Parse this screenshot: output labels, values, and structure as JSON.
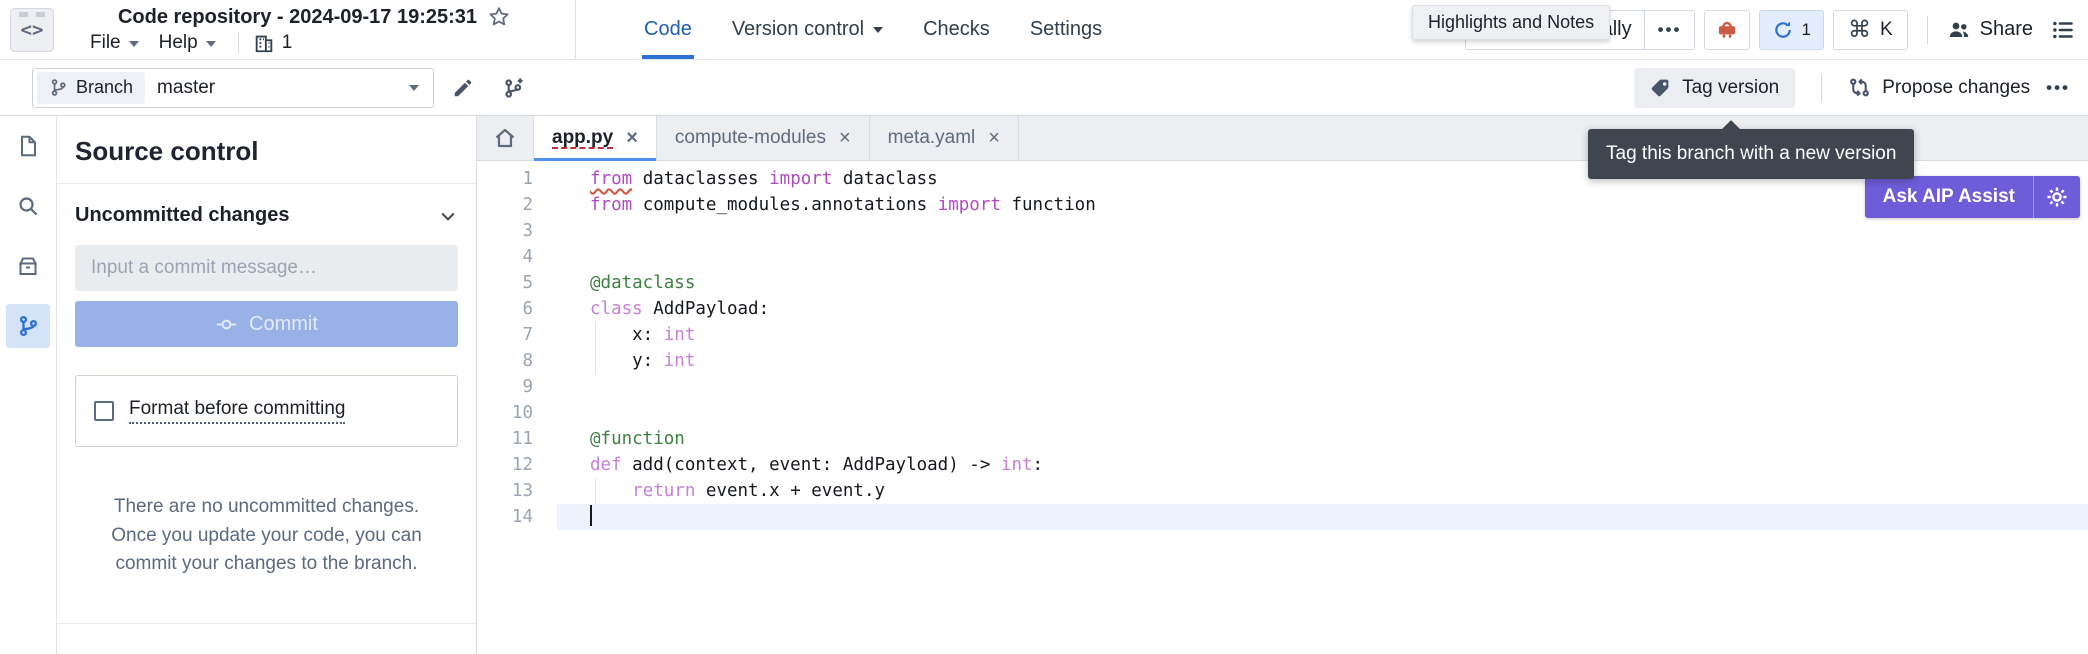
{
  "window": {
    "title": "Code repository - 2024-09-17 19:25:31"
  },
  "menubar": {
    "file_label": "File",
    "help_label": "Help",
    "resource_count": "1"
  },
  "nav": {
    "tabs": [
      {
        "label": "Code",
        "active": true
      },
      {
        "label": "Version control",
        "has_caret": true
      },
      {
        "label": "Checks"
      },
      {
        "label": "Settings"
      }
    ]
  },
  "top_actions": {
    "tooltip_text": "Highlights and Notes",
    "partial_button_label": "ally",
    "more_label": "•••",
    "build_count": "1",
    "shortcut_modifier": "⌘",
    "shortcut_key": "K",
    "share_label": "Share"
  },
  "branch_bar": {
    "branch_chip_label": "Branch",
    "branch_name": "master",
    "tag_version_label": "Tag version",
    "propose_changes_label": "Propose changes",
    "more_label": "•••"
  },
  "tag_tooltip": {
    "text": "Tag this branch with a new version"
  },
  "aip_assist": {
    "label": "Ask AIP Assist"
  },
  "source_control": {
    "title": "Source control",
    "section_title": "Uncommitted changes",
    "commit_placeholder": "Input a commit message…",
    "commit_label": "Commit",
    "format_label": "Format before committing",
    "empty_state_text": "There are no uncommitted changes. Once you update your code, you can commit your changes to the branch."
  },
  "editor": {
    "tabs": [
      {
        "label": "app.py",
        "active": true,
        "error_underline": true
      },
      {
        "label": "compute-modules"
      },
      {
        "label": "meta.yaml"
      }
    ],
    "code": {
      "language": "python",
      "current_line": 14,
      "lines": [
        {
          "n": 1,
          "tokens": [
            {
              "c": "k e",
              "t": "from"
            },
            {
              "c": "t",
              "t": " dataclasses "
            },
            {
              "c": "k",
              "t": "import"
            },
            {
              "c": "t",
              "t": " dataclass"
            }
          ]
        },
        {
          "n": 2,
          "tokens": [
            {
              "c": "k",
              "t": "from"
            },
            {
              "c": "t",
              "t": " compute_modules.annotations "
            },
            {
              "c": "k",
              "t": "import"
            },
            {
              "c": "t",
              "t": " function"
            }
          ]
        },
        {
          "n": 3,
          "tokens": []
        },
        {
          "n": 4,
          "tokens": []
        },
        {
          "n": 5,
          "tokens": [
            {
              "c": "d",
              "t": "@dataclass"
            }
          ]
        },
        {
          "n": 6,
          "tokens": [
            {
              "c": "k2",
              "t": "class"
            },
            {
              "c": "t",
              "t": " AddPayload:"
            }
          ]
        },
        {
          "n": 7,
          "guide": true,
          "tokens": [
            {
              "c": "t",
              "t": "    x: "
            },
            {
              "c": "k2",
              "t": "int"
            }
          ]
        },
        {
          "n": 8,
          "guide": true,
          "tokens": [
            {
              "c": "t",
              "t": "    y: "
            },
            {
              "c": "k2",
              "t": "int"
            }
          ]
        },
        {
          "n": 9,
          "tokens": []
        },
        {
          "n": 10,
          "tokens": []
        },
        {
          "n": 11,
          "tokens": [
            {
              "c": "d",
              "t": "@function"
            }
          ]
        },
        {
          "n": 12,
          "tokens": [
            {
              "c": "k2",
              "t": "def"
            },
            {
              "c": "t",
              "t": " add(context, event: AddPayload) -> "
            },
            {
              "c": "k2",
              "t": "int"
            },
            {
              "c": "t",
              "t": ":"
            }
          ]
        },
        {
          "n": 13,
          "guide": true,
          "tokens": [
            {
              "c": "t",
              "t": "    "
            },
            {
              "c": "k2",
              "t": "return"
            },
            {
              "c": "t",
              "t": " event.x + event.y"
            }
          ]
        },
        {
          "n": 14,
          "current": true,
          "tokens": []
        }
      ]
    }
  },
  "colors": {
    "accent_blue": "#2d72d2",
    "active_tab_underline": "#4c90f0",
    "purple_button": "#6e5cd9",
    "tooltip_dark_bg": "#3f4650",
    "robot_red": "#cd5a46",
    "disabled_commit_blue": "#98b2e8",
    "keyword_purple": "#b14ac2",
    "keyword_light_purple": "#c77fd9",
    "decorator_green": "#3d8140",
    "error_red": "#d64f3f",
    "current_line_bg": "#edf3fc",
    "selected_rail_bg": "#d4e3f8"
  }
}
